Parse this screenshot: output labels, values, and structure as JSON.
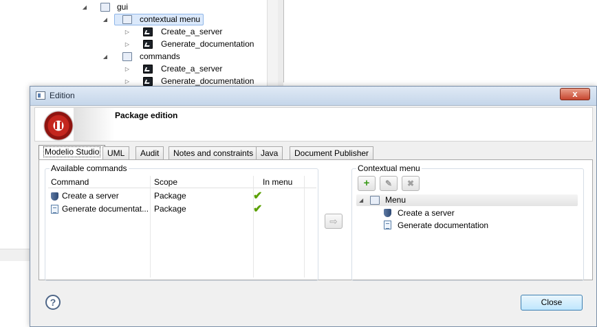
{
  "background_tree": {
    "items": [
      {
        "label": "gui"
      },
      {
        "label": "contextual menu"
      },
      {
        "label": "Create_a_server"
      },
      {
        "label": "Generate_documentation"
      },
      {
        "label": "commands"
      },
      {
        "label": "Create_a_server"
      },
      {
        "label": "Generate_documentation"
      }
    ]
  },
  "dialog": {
    "title": "Edition",
    "close_glyph": "x",
    "header_title": "Package edition",
    "tabs": [
      {
        "label": "Modelio Studio"
      },
      {
        "label": "UML"
      },
      {
        "label": "Audit"
      },
      {
        "label": "Notes and constraints"
      },
      {
        "label": "Java"
      },
      {
        "label": "Document Publisher"
      }
    ],
    "available_commands": {
      "label": "Available commands",
      "columns": [
        "Command",
        "Scope",
        "In menu"
      ],
      "rows": [
        {
          "command": "Create a server",
          "scope": "Package",
          "icon": "shield-icon"
        },
        {
          "command": "Generate documentat...",
          "scope": "Package",
          "icon": "document-icon"
        }
      ],
      "check_glyph": "✔"
    },
    "move_glyph": "⇨",
    "contextual_menu": {
      "label": "Contextual menu",
      "add_glyph": "+",
      "edit_glyph": "✎",
      "delete_glyph": "✖",
      "root": "Menu",
      "children": [
        {
          "label": "Create a server",
          "icon": "shield-icon"
        },
        {
          "label": "Generate documentation",
          "icon": "document-icon"
        }
      ]
    },
    "help_glyph": "?",
    "close_label": "Close"
  },
  "colors": {
    "accent": "#3c7fb1",
    "check": "#5aa000",
    "add": "#3a9a1a",
    "close_title": "#c7462f"
  }
}
